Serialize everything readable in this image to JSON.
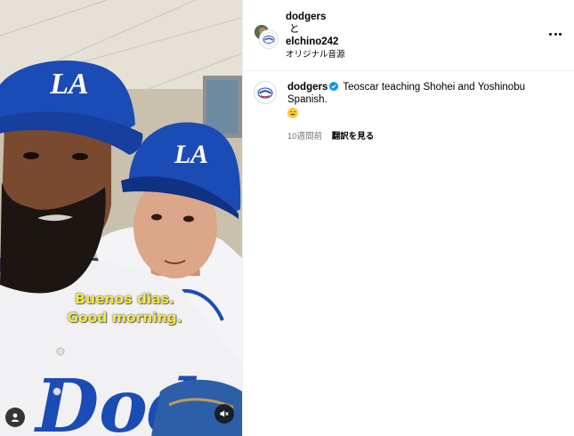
{
  "media": {
    "cap_line1": "Buenos dias.",
    "cap_line2": "Good morning.",
    "cap_logo": "LA",
    "user_tag_icon": "person-icon",
    "mute_icon": "speaker-muted-icon"
  },
  "header": {
    "user1": "dodgers",
    "conj": "と",
    "user2": "elchino242",
    "audio": "オリジナル音源",
    "more_icon": "more-horizontal-icon"
  },
  "post": {
    "username": "dodgers",
    "verified_icon": "verified-badge-icon",
    "caption": "Teoscar teaching Shohei and Yoshinobu Spanish.",
    "emoji_icon": "grinning-sweat-emoji-icon",
    "time_ago": "10週間前",
    "translate": "翻訳を見る"
  },
  "colors": {
    "verified": "#0095f6",
    "caption_yellow": "#f2e84a",
    "dodger_blue": "#1b4bb5",
    "muted_text": "#737373"
  }
}
